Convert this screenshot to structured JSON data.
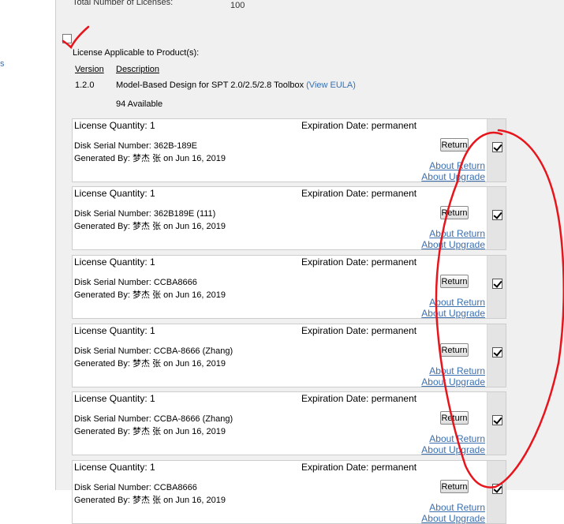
{
  "left": {
    "fragment": "s"
  },
  "header": {
    "total_label": "Total Number of Licenses:",
    "total_value": "100",
    "applicable_label": "License Applicable to Product(s):",
    "col_version": "Version",
    "col_description": "Description"
  },
  "product": {
    "version": "1.2.0",
    "description": "Model-Based Design for SPT 2.0/2.5/2.8 Toolbox",
    "eula_link": "(View EULA)",
    "available": "94 Available"
  },
  "licenses": [
    {
      "quantity": "License Quantity: 1",
      "expiration": "Expiration Date: permanent",
      "serial": "Disk Serial Number: 362B-189E",
      "generated": "Generated By: 梦杰 张 on Jun 16, 2019"
    },
    {
      "quantity": "License Quantity: 1",
      "expiration": "Expiration Date: permanent",
      "serial": "Disk Serial Number: 362B189E (111)",
      "generated": "Generated By: 梦杰 张 on Jun 16, 2019"
    },
    {
      "quantity": "License Quantity: 1",
      "expiration": "Expiration Date: permanent",
      "serial": "Disk Serial Number: CCBA8666",
      "generated": "Generated By: 梦杰 张 on Jun 16, 2019"
    },
    {
      "quantity": "License Quantity: 1",
      "expiration": "Expiration Date: permanent",
      "serial": "Disk Serial Number: CCBA-8666 (Zhang)",
      "generated": "Generated By: 梦杰 张 on Jun 16, 2019"
    },
    {
      "quantity": "License Quantity: 1",
      "expiration": "Expiration Date: permanent",
      "serial": "Disk Serial Number: CCBA-8666 (Zhang)",
      "generated": "Generated By: 梦杰 张 on Jun 16, 2019"
    },
    {
      "quantity": "License Quantity: 1",
      "expiration": "Expiration Date: permanent",
      "serial": "Disk Serial Number: CCBA8666",
      "generated": "Generated By: 梦杰 张 on Jun 16, 2019"
    }
  ],
  "actions": {
    "return_label": "Return",
    "about_return": "About Return",
    "about_upgrade": "About Upgrade"
  },
  "colors": {
    "link": "#3a6fb0",
    "annotation": "#e8141c"
  }
}
